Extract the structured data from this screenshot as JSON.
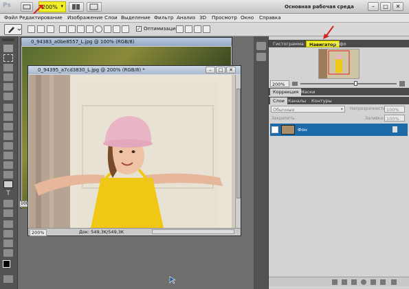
{
  "appbar": {
    "logo": "Ps",
    "zoom_value": "200%",
    "workspace": "Основная рабочая среда"
  },
  "menu": [
    "Файл",
    "Редактирование",
    "Изображение",
    "Слои",
    "Выделение",
    "Фильтр",
    "Анализ",
    "3D",
    "Просмотр",
    "Окно",
    "Справка"
  ],
  "options": {
    "optimization_label": "Оптимизация",
    "checkbox_mark": "✓"
  },
  "documents": [
    {
      "title": "0_94383_a0be8557_L.jpg @ 100% (RGB/8)",
      "zoom": "100"
    },
    {
      "title": "0_94395_a7cd3830_L.jpg @ 200% (RGB/8) *",
      "zoom": "200%",
      "doc_size": "Док: 549,3K/549,3K"
    }
  ],
  "navigator": {
    "tabs": [
      "Гистограмма",
      "Навигатор",
      "Инфо"
    ],
    "zoom": "200%"
  },
  "adjust_tabs": [
    "Коррекция",
    "Маски"
  ],
  "layers": {
    "tabs": [
      "Слои",
      "Каналы",
      "Контуры"
    ],
    "blend_mode": "Обычные",
    "opacity_label": "Непрозрачность:",
    "opacity_value": "100%",
    "lock_label": "Закрепить:",
    "fill_label": "Заливка:",
    "fill_value": "100%",
    "layer_name": "Фон"
  },
  "colors": {
    "highlight": "#f2ef2a",
    "selected_layer": "#1c6aa8",
    "arrow": "#d42020"
  }
}
